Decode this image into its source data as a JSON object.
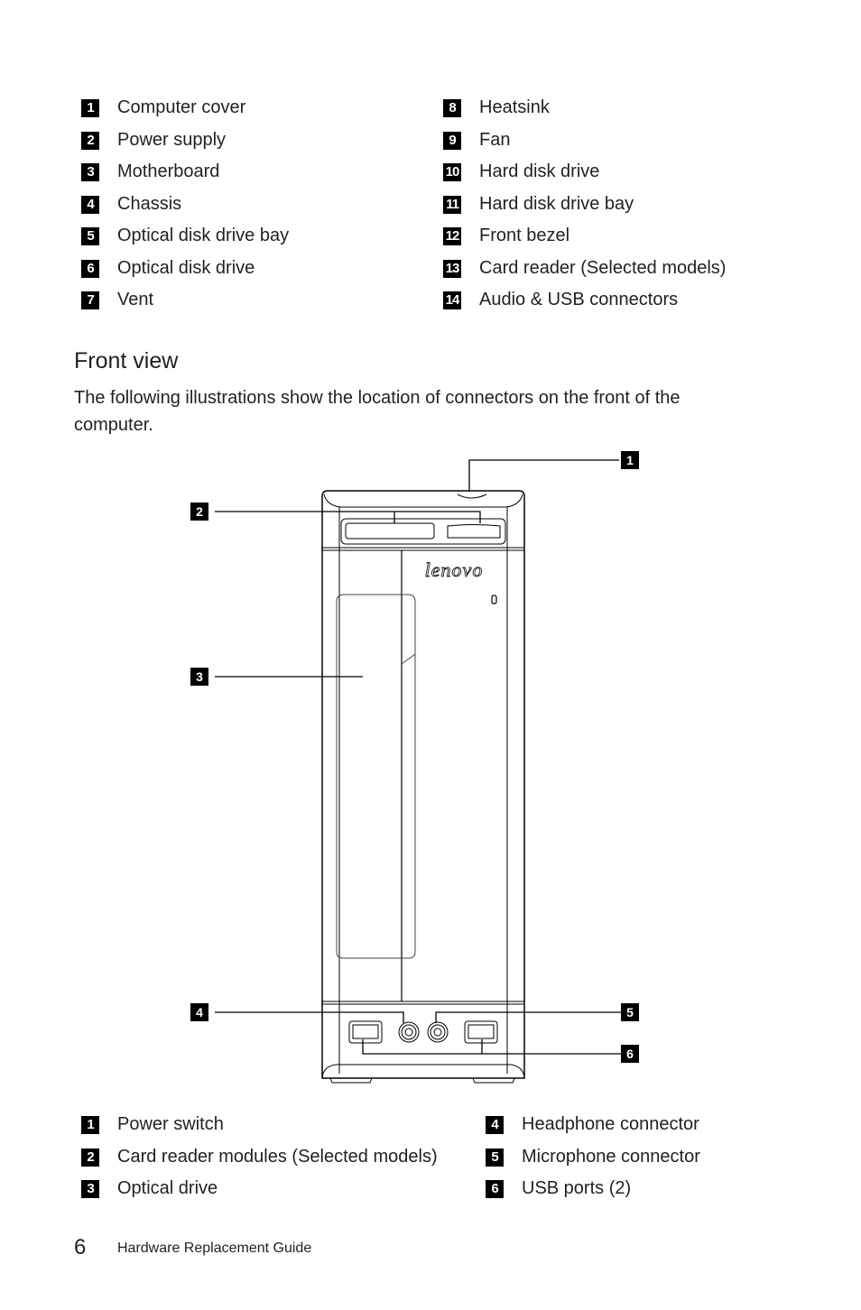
{
  "parts_list": {
    "left": [
      {
        "num": "1",
        "label": "Computer cover"
      },
      {
        "num": "2",
        "label": "Power supply"
      },
      {
        "num": "3",
        "label": "Motherboard"
      },
      {
        "num": "4",
        "label": "Chassis"
      },
      {
        "num": "5",
        "label": "Optical disk drive bay"
      },
      {
        "num": "6",
        "label": "Optical disk drive"
      },
      {
        "num": "7",
        "label": "Vent"
      }
    ],
    "right": [
      {
        "num": "8",
        "label": "Heatsink"
      },
      {
        "num": "9",
        "label": "Fan"
      },
      {
        "num": "10",
        "label": "Hard disk drive"
      },
      {
        "num": "11",
        "label": "Hard disk drive bay"
      },
      {
        "num": "12",
        "label": "Front bezel"
      },
      {
        "num": "13",
        "label": "Card reader (Selected models)"
      },
      {
        "num": "14",
        "label": "Audio & USB connectors"
      }
    ]
  },
  "section": {
    "title": "Front view",
    "intro": "The following illustrations show the location of connectors on the front of the computer."
  },
  "diagram": {
    "brand_logo": "lenovo",
    "callouts": [
      "1",
      "2",
      "3",
      "4",
      "5",
      "6"
    ]
  },
  "connectors_list": {
    "left": [
      {
        "num": "1",
        "label": "Power switch"
      },
      {
        "num": "2",
        "label": "Card reader modules (Selected models)"
      },
      {
        "num": "3",
        "label": "Optical drive"
      }
    ],
    "right": [
      {
        "num": "4",
        "label": "Headphone connector"
      },
      {
        "num": "5",
        "label": "Microphone connector"
      },
      {
        "num": "6",
        "label": "USB ports (2)"
      }
    ]
  },
  "footer": {
    "page_number": "6",
    "title": "Hardware Replacement Guide"
  }
}
